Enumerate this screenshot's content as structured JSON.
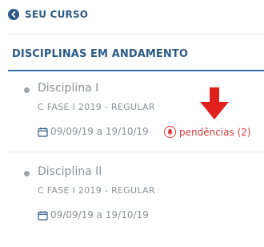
{
  "back_link": {
    "label": "SEU CURSO",
    "icon": "chevron-left-circle-icon"
  },
  "section": {
    "title": "DISCIPLINAS EM ANDAMENTO"
  },
  "courses": [
    {
      "name": "Disciplina I",
      "meta": "C FASE I 2019 - REGULAR",
      "dates": "09/09/19 a 19/10/19",
      "pending_label": "pendências (2)"
    },
    {
      "name": "Disciplina II",
      "meta": "C FASE I 2019 - REGULAR",
      "dates": "09/09/19 a 19/10/19"
    }
  ],
  "colors": {
    "primary": "#2c5a86",
    "muted_text": "#8c9196",
    "alert": "#d33b3b",
    "annotation_arrow": "#e0201d"
  }
}
